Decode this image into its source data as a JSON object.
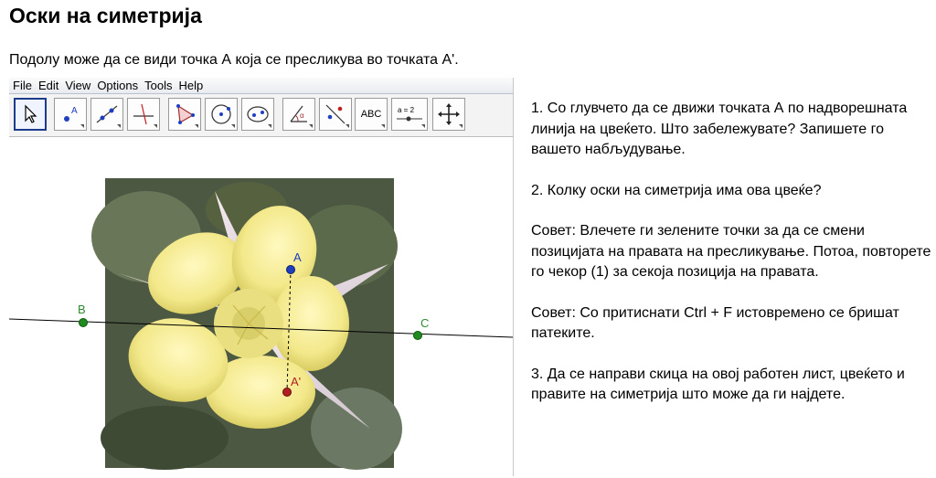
{
  "page": {
    "title": "Оски на симетрија",
    "intro": "Подолу може да се види точка А која се пресликува во точката А'."
  },
  "applet": {
    "menu": [
      "File",
      "Edit",
      "View",
      "Options",
      "Tools",
      "Help"
    ],
    "tools": [
      {
        "name": "move-tool-icon",
        "label": ""
      },
      {
        "name": "point-tool-icon",
        "label": "A"
      },
      {
        "name": "line-tool-icon",
        "label": ""
      },
      {
        "name": "perpendicular-line-tool-icon",
        "label": ""
      },
      {
        "name": "polygon-tool-icon",
        "label": ""
      },
      {
        "name": "circle-center-point-tool-icon",
        "label": ""
      },
      {
        "name": "conic-tool-icon",
        "label": ""
      },
      {
        "name": "angle-tool-icon",
        "label": "α"
      },
      {
        "name": "reflect-line-tool-icon",
        "label": ""
      },
      {
        "name": "text-tool-icon",
        "label": "ABC"
      },
      {
        "name": "slider-tool-icon",
        "label": "a = 2"
      },
      {
        "name": "move-graphics-view-tool-icon",
        "label": ""
      }
    ],
    "points": {
      "A": "A",
      "A_prime": "A'",
      "B": "B",
      "C": "C"
    },
    "colors": {
      "point_A": "#1f3fbf",
      "point_A_prime": "#b02020",
      "points_BC": "#1f8a1f",
      "label_A": "#1f3fbf",
      "label_BC": "#2e8b2e",
      "label_A_prime": "#b02020"
    }
  },
  "instructions": [
    "1. Со глувчето да се движи точката А по надворешната линија на цвеќето. Што забележувате? Запишете го вашето набљудување.",
    "2. Колку оски на симетрија има ова цвеќе?",
    "Совет: Влечете ги зелените точки за да се смени позицијата на правата на пресликување. Потоа, повторете го чекор (1) за секоја позиција на правата.",
    "Совет: Со притиснати Ctrl + F истовремено се бришат патеките.",
    "3. Да се направи скица на овој работен лист, цвеќето и правите на симетрија што може да ги најдете."
  ]
}
